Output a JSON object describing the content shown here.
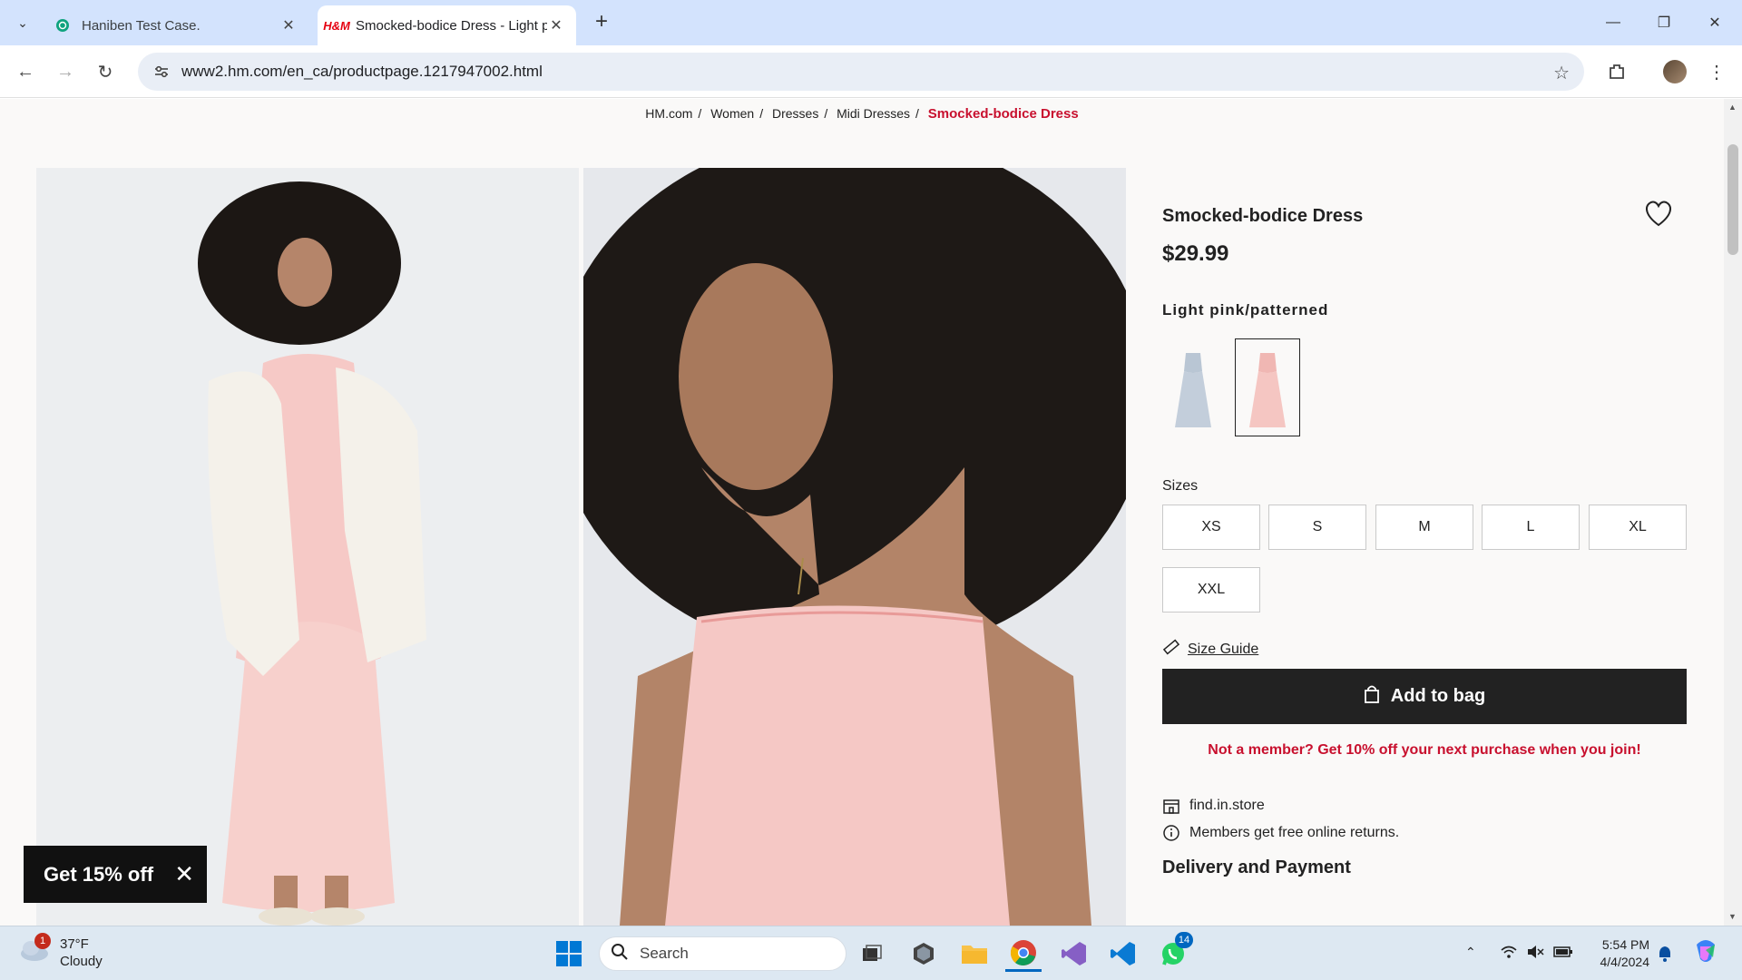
{
  "browser": {
    "tabs": [
      {
        "title": "Haniben Test Case.",
        "active": false
      },
      {
        "title": "Smocked-bodice Dress - Light p",
        "active": true
      }
    ],
    "url": "www2.hm.com/en_ca/productpage.1217947002.html"
  },
  "breadcrumb": [
    "HM.com",
    "Women",
    "Dresses",
    "Midi Dresses",
    "Smocked-bodice Dress"
  ],
  "breadcrumb_sep": "/",
  "product": {
    "name": "Smocked-bodice Dress",
    "price": "$29.99",
    "color_name": "Light pink/patterned",
    "sizes_label": "Sizes",
    "sizes": [
      "XS",
      "S",
      "M",
      "L",
      "XL",
      "XXL"
    ],
    "size_guide": "Size Guide",
    "add_to_bag": "Add to bag",
    "member_offer": "Not a member? Get 10% off your next purchase when you join!",
    "find_in_store": "find.in.store",
    "free_returns": "Members get free online returns.",
    "delivery_heading": "Delivery and Payment"
  },
  "promo": {
    "label": "Get 15% off"
  },
  "taskbar": {
    "weather_temp": "37°F",
    "weather_desc": "Cloudy",
    "weather_badge": "1",
    "search_placeholder": "Search",
    "whatsapp_badge": "14",
    "time": "5:54 PM",
    "date": "4/4/2024"
  },
  "colors": {
    "brand_red": "#c8102e",
    "button_dark": "#222222"
  }
}
